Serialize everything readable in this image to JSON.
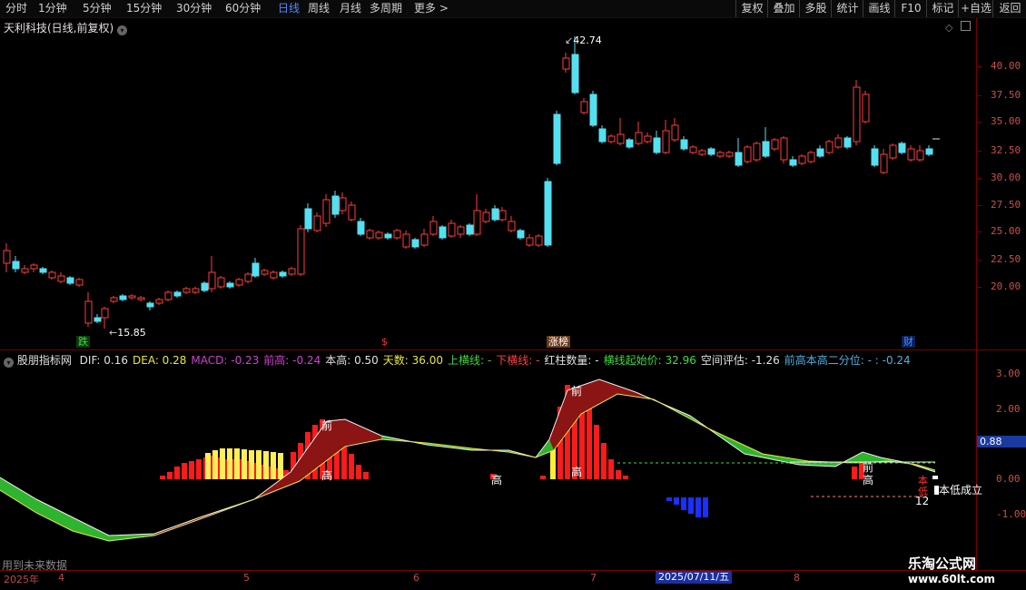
{
  "toolbar": {
    "periods": [
      "分时",
      "1分钟",
      "5分钟",
      "15分钟",
      "30分钟",
      "60分钟",
      "日线",
      "周线",
      "月线",
      "多周期",
      "更多 >"
    ],
    "active_period": "日线",
    "right_buttons": [
      "复权",
      "叠加",
      "多股",
      "统计",
      "画线",
      "F10",
      "标记",
      "+自选",
      "返回"
    ]
  },
  "main_chart": {
    "title": "天利科技(日线,前复权)",
    "price_axis": [
      "40.00",
      "37.50",
      "35.00",
      "32.50",
      "30.00",
      "27.50",
      "25.00",
      "22.50",
      "20.00"
    ],
    "high_label": "42.74",
    "low_label": "15.85",
    "markers": [
      {
        "text": "跌",
        "color": "#3ddc3d"
      },
      {
        "text": "$",
        "color": "#ff3030"
      },
      {
        "text": "涨榜",
        "color": "#ffffff"
      },
      {
        "text": "财",
        "color": "#4d8cff"
      }
    ]
  },
  "indicator": {
    "name": "股朋指标网",
    "values": [
      {
        "label": "DIF: 0.16",
        "color": "#e0e0e0"
      },
      {
        "label": "DEA: 0.28",
        "color": "#e8e83c"
      },
      {
        "label": "MACD: -0.23",
        "color": "#d040d0"
      },
      {
        "label": "前高: -0.24",
        "color": "#d040d0"
      },
      {
        "label": "本高: 0.50",
        "color": "#e0e0e0"
      },
      {
        "label": "天数: 36.00",
        "color": "#e8e83c"
      },
      {
        "label": "上横线: -",
        "color": "#3ddc3d"
      },
      {
        "label": "下横线: -",
        "color": "#ff4040"
      },
      {
        "label": "红柱数量: -",
        "color": "#e0e0e0"
      },
      {
        "label": "横线起始价: 32.96",
        "color": "#3ddc3d"
      },
      {
        "label": "空间评估: -1.26",
        "color": "#e0e0e0"
      },
      {
        "label": "前高本高二分位: - : -0.24",
        "color": "#4db0e0"
      }
    ],
    "axis": [
      "3.00",
      "2.00",
      "1.00",
      "0.00",
      "-1.00"
    ],
    "current_value": "0.88",
    "annotations": {
      "qian": "前",
      "gao": "高",
      "ben_di": "本低成立",
      "count": "12",
      "ben": "本",
      "di": "低"
    }
  },
  "footer": {
    "note": "用到未来数据",
    "year": "2025年",
    "months": [
      "4",
      "5",
      "6",
      "7",
      "8"
    ],
    "cursor_date": "2025/07/11/五",
    "watermark_title": "乐淘公式网",
    "watermark_url": "www.60lt.com"
  },
  "colors": {
    "up": "#ff3c3c",
    "down": "#54e0f0",
    "accent": "#4d8cff"
  }
}
